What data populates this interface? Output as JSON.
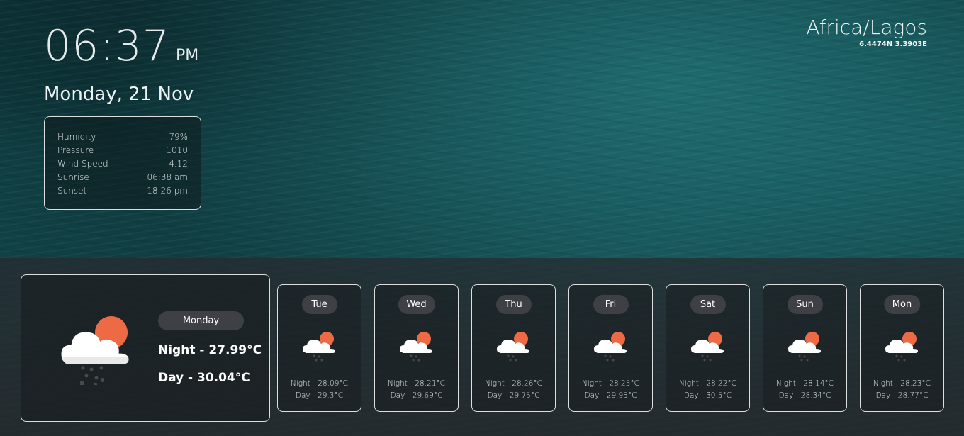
{
  "clock": {
    "time": "06:37",
    "ampm": "PM",
    "date": "Monday, 21 Nov"
  },
  "details": [
    {
      "label": "Humidity",
      "value": "79%"
    },
    {
      "label": "Pressure",
      "value": "1010"
    },
    {
      "label": "Wind Speed",
      "value": "4.12"
    },
    {
      "label": "Sunrise",
      "value": "06:38 am"
    },
    {
      "label": "Sunset",
      "value": "18:26 pm"
    }
  ],
  "location": {
    "timezone": "Africa/Lagos",
    "coords": "6.4474N 3.3903E"
  },
  "today": {
    "day": "Monday",
    "night": "Night - 27.99°C",
    "day_temp": "Day - 30.04°C",
    "icon": "rain-cloud-sun-icon"
  },
  "forecast": [
    {
      "day": "Tue",
      "night": "Night - 28.09°C",
      "day_temp": "Day - 29.3°C"
    },
    {
      "day": "Wed",
      "night": "Night - 28.21°C",
      "day_temp": "Day - 29.69°C"
    },
    {
      "day": "Thu",
      "night": "Night - 28.26°C",
      "day_temp": "Day - 29.75°C"
    },
    {
      "day": "Fri",
      "night": "Night - 28.25°C",
      "day_temp": "Day - 29.95°C"
    },
    {
      "day": "Sat",
      "night": "Night - 28.22°C",
      "day_temp": "Day - 30.5°C"
    },
    {
      "day": "Sun",
      "night": "Night - 28.14°C",
      "day_temp": "Day - 28.34°C"
    },
    {
      "day": "Mon",
      "night": "Night - 28.23°C",
      "day_temp": "Day - 28.77°C"
    }
  ],
  "colors": {
    "sun": "#ee6a45",
    "cloud": "#ffffff",
    "rain": "#4a4a4a",
    "pill": "#3e4045"
  }
}
